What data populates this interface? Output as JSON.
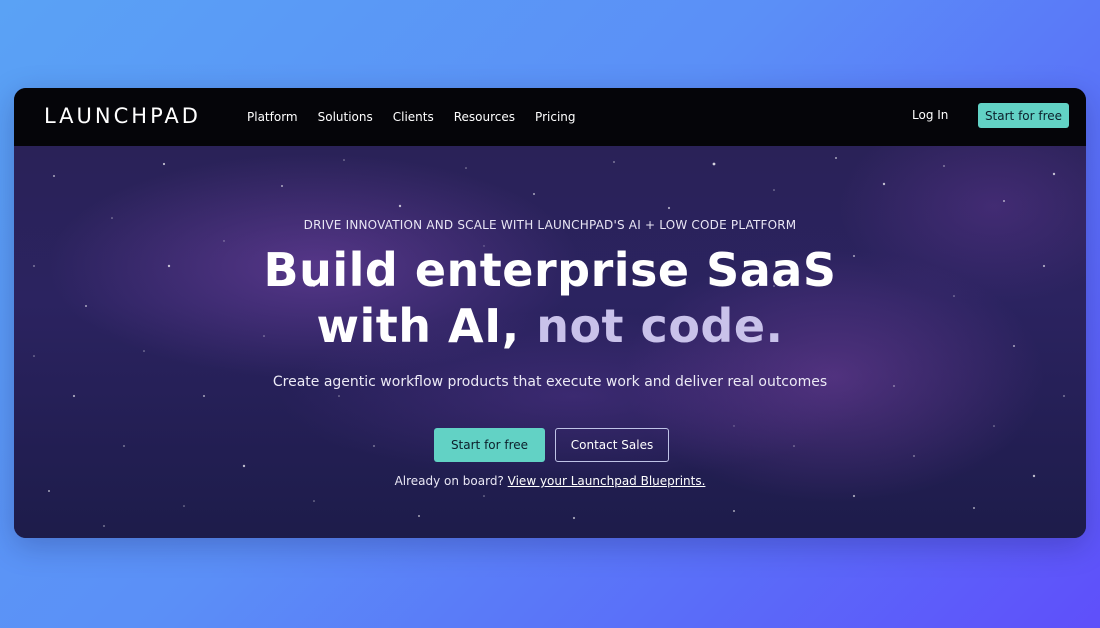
{
  "nav": {
    "logo": "LAUNCHPAD",
    "links": [
      "Platform",
      "Solutions",
      "Clients",
      "Resources",
      "Pricing"
    ],
    "login_label": "Log In",
    "cta_label": "Start for free"
  },
  "hero": {
    "eyebrow": "DRIVE INNOVATION AND SCALE WITH LAUNCHPAD'S AI + LOW CODE PLATFORM",
    "headline_line1": "Build enterprise SaaS",
    "headline_line2_a": "with AI, ",
    "headline_line2_b": "not code.",
    "subheadline": "Create agentic workflow products that execute work and deliver real outcomes",
    "primary_cta": "Start for free",
    "secondary_cta": "Contact Sales",
    "signin_prefix": "Already on board? ",
    "signin_link": "View your Launchpad Blueprints."
  },
  "colors": {
    "accent": "#62d2c5",
    "nav_bg": "#050509",
    "hero_bg": "#2a2258",
    "headline_muted": "#c9c2ea"
  }
}
